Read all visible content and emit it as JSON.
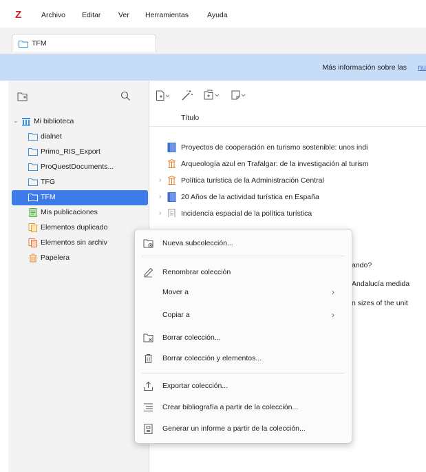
{
  "app": {
    "logo": "Z"
  },
  "menubar": {
    "items": [
      "Archivo",
      "Editar",
      "Ver",
      "Herramientas",
      "Ayuda"
    ]
  },
  "tab": {
    "label": "TFM",
    "icon": "folder-icon"
  },
  "banner": {
    "text": "Más información sobre las",
    "link": "nu"
  },
  "library": {
    "root": "Mi biblioteca",
    "collections": [
      "dialnet",
      "Primo_RIS_Export",
      "ProQuestDocuments...",
      "TFG",
      "TFM"
    ],
    "selected": "TFM",
    "special": [
      "Mis publicaciones",
      "Elementos duplicado",
      "Elementos sin archiv",
      "Papelera"
    ]
  },
  "items_header": {
    "title_col": "Título"
  },
  "items": [
    {
      "title": "Proyectos de cooperación en turismo sostenible: unos indi",
      "icon": "book-icon",
      "expandable": false
    },
    {
      "title": "Arqueología azul en Trafalgar: de la investigación al turism",
      "icon": "document-icon",
      "expandable": false
    },
    {
      "title": "Política turística de la Administración Central",
      "icon": "document-icon",
      "expandable": true
    },
    {
      "title": "20 Años de la actividad turística en España",
      "icon": "book-icon",
      "expandable": true
    },
    {
      "title": "Incidencia espacial de la política turística",
      "icon": "document-icon",
      "expandable": true
    }
  ],
  "partial_items": [
    "ando?",
    "Andalucía medida",
    "n sizes of the unit"
  ],
  "context_menu": {
    "groups": [
      [
        {
          "label": "Nueva subcolección...",
          "icon": "new-subcollection-icon"
        }
      ],
      [
        {
          "label": "Renombrar colección",
          "icon": "pencil-icon"
        },
        {
          "label": "Mover a",
          "icon": "",
          "submenu": true
        },
        {
          "label": "Copiar a",
          "icon": "",
          "submenu": true
        },
        {
          "label": "Borrar colección...",
          "icon": "delete-collection-icon"
        },
        {
          "label": "Borrar colección y elementos...",
          "icon": "trash-icon"
        }
      ],
      [
        {
          "label": "Exportar colección...",
          "icon": "export-icon"
        },
        {
          "label": "Crear bibliografía a partir de la colección...",
          "icon": "bibliography-icon"
        },
        {
          "label": "Generar un informe a partir de la colección...",
          "icon": "report-icon"
        }
      ]
    ]
  },
  "colors": {
    "selection": "#3d7ce8",
    "banner": "#c7dcf7",
    "logo": "#d21d2b",
    "folder_stroke": "#3a8fd6",
    "book_blue": "#3d6fd0",
    "archaeology_orange": "#e67e22"
  }
}
